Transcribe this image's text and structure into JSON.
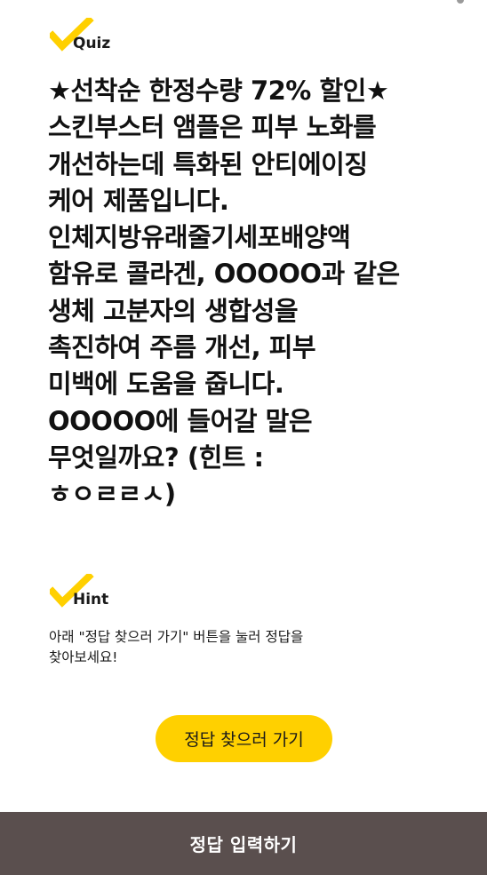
{
  "quiz_label": "Quiz",
  "question": "★선착순 한정수량 72% 할인★\n스킨부스터 앰플은 피부 노화를\n개선하는데 특화된 안티에이징\n케어 제품입니다.\n인체지방유래줄기세포배양액\n함유로 콜라겐, OOOOO과 같은\n생체 고분자의 생합성을\n촉진하여 주름 개선, 피부\n미백에 도움을 줍니다.\nOOOOO에 들어갈 말은\n무엇일까요? (힌트 :\nㅎㅇㄹㄹㅅ)",
  "hint_label": "Hint",
  "hint_text": "아래 \"정답 찾으러 가기\" 버튼을 눌러 정답을\n찾아보세요!",
  "find_answer_button": "정답 찾으러 가기",
  "submit_answer_bar": "정답 입력하기",
  "colors": {
    "accent_yellow": "#ffd000",
    "bottom_bar": "#5a4f4e",
    "text": "#111111"
  }
}
